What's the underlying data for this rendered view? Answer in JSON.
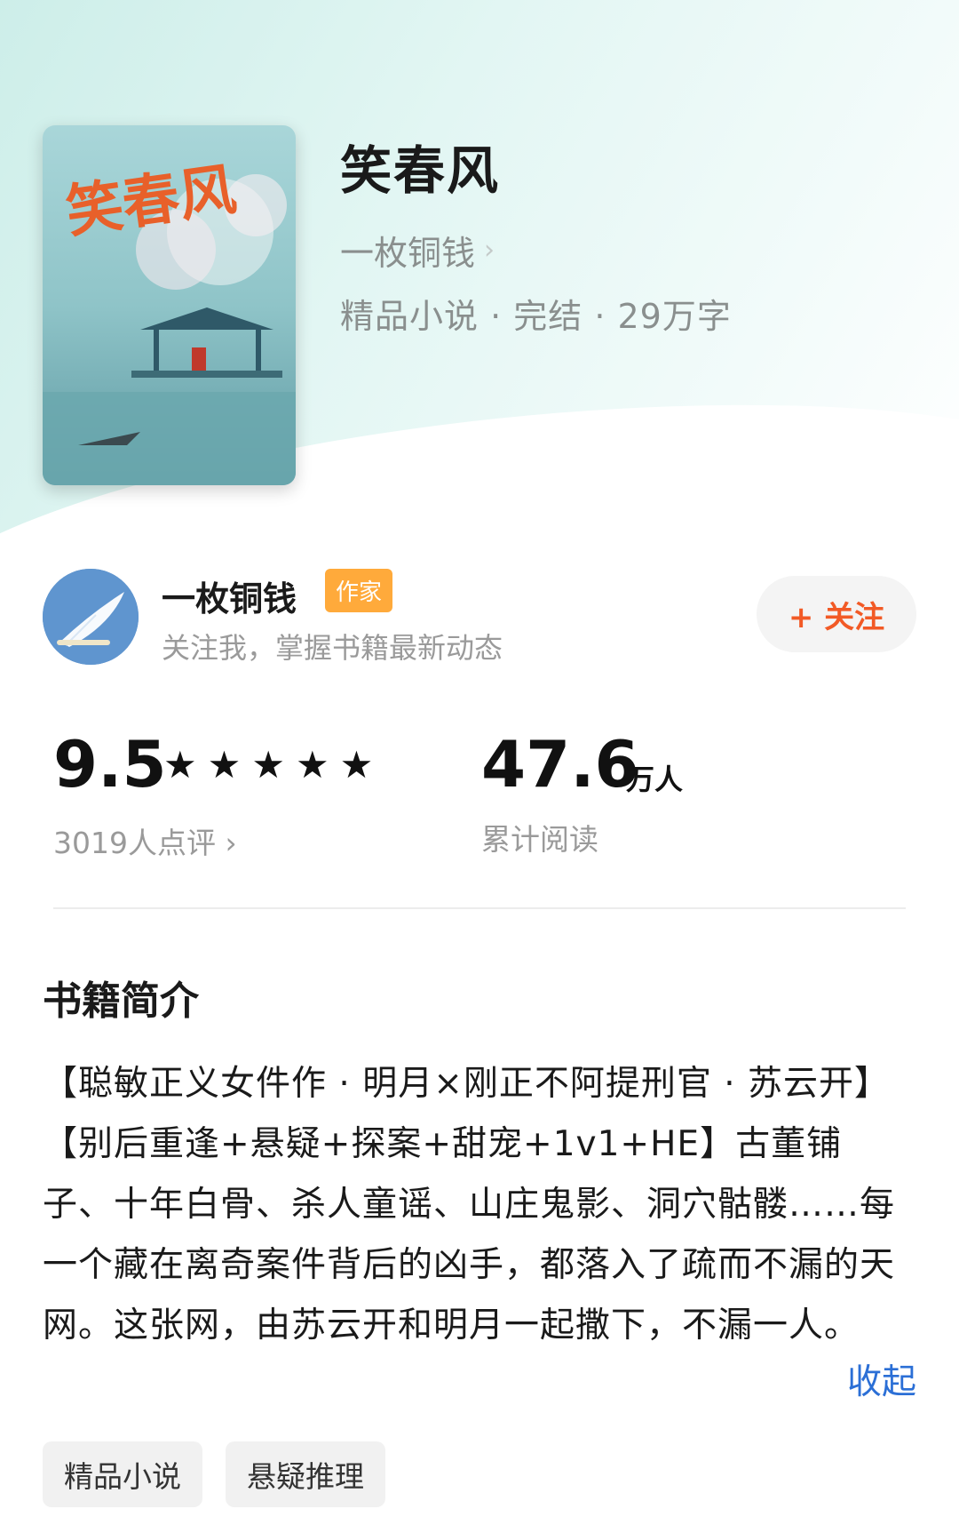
{
  "book": {
    "title": "笑春风",
    "author": "一枚铜钱",
    "meta": "精品小说 · 完结 · 29万字"
  },
  "author_card": {
    "name": "一枚铜钱",
    "badge": "作家",
    "subtitle": "关注我，掌握书籍最新动态",
    "follow_label": "+ 关注"
  },
  "stats": {
    "score": "9.5",
    "stars": [
      "★",
      "★",
      "★",
      "★",
      "★"
    ],
    "review_count": "3019人点评 ›",
    "reads": "47.6",
    "reads_unit": "万人",
    "reads_label": "累计阅读"
  },
  "intro": {
    "heading": "书籍简介",
    "text": "【聪敏正义女件作 · 明月×刚正不阿提刑官 · 苏云开】【别后重逢+悬疑+探案+甜宠+1v1+HE】古董铺子、十年白骨、杀人童谣、山庄鬼影、洞穴骷髅……每一个藏在离奇案件背后的凶手，都落入了疏而不漏的天网。这张网，由苏云开和明月一起撒下，不漏一人。",
    "collapse_label": "收起"
  },
  "tags": [
    "精品小说",
    "悬疑推理"
  ],
  "colors": {
    "accent_orange": "#f25a26",
    "badge": "#ffaa3b",
    "link_blue": "#2b6fd6"
  }
}
